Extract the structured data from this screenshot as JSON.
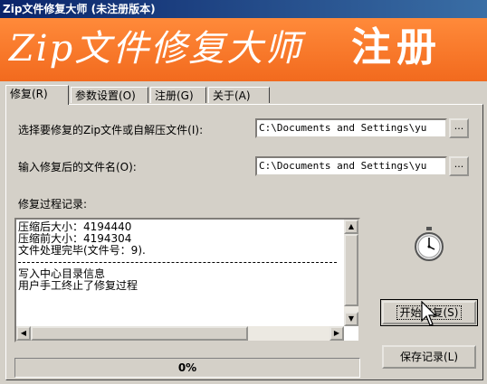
{
  "window": {
    "title": "Zip文件修复大师 (未注册版本)"
  },
  "banner": {
    "title": "Zip文件修复大师",
    "register": "注册"
  },
  "tabs": [
    {
      "label": "修复(R)",
      "active": true
    },
    {
      "label": "参数设置(O)",
      "active": false
    },
    {
      "label": "注册(G)",
      "active": false
    },
    {
      "label": "关于(A)",
      "active": false
    }
  ],
  "form": {
    "source_label": "选择要修复的Zip文件或自解压文件(I):",
    "source_value": "C:\\Documents and Settings\\yu",
    "source_browse": "...",
    "output_label": "输入修复后的文件名(O):",
    "output_value": "C:\\Documents and Settings\\yu",
    "output_browse": "..."
  },
  "log": {
    "label": "修复过程记录:",
    "lines_before": [
      "压缩后大小：4194440",
      "压缩前大小：4194304",
      "文件处理完毕(文件号：9)."
    ],
    "lines_after": [
      "写入中心目录信息",
      "用户手工终止了修复过程"
    ]
  },
  "progress": {
    "text": "0%",
    "fraction": 0
  },
  "buttons": {
    "start": "开始修复(S)",
    "save_log": "保存记录(L)"
  },
  "icons": {
    "stopwatch": "stopwatch-icon",
    "cursor": "cursor-arrow-icon"
  }
}
